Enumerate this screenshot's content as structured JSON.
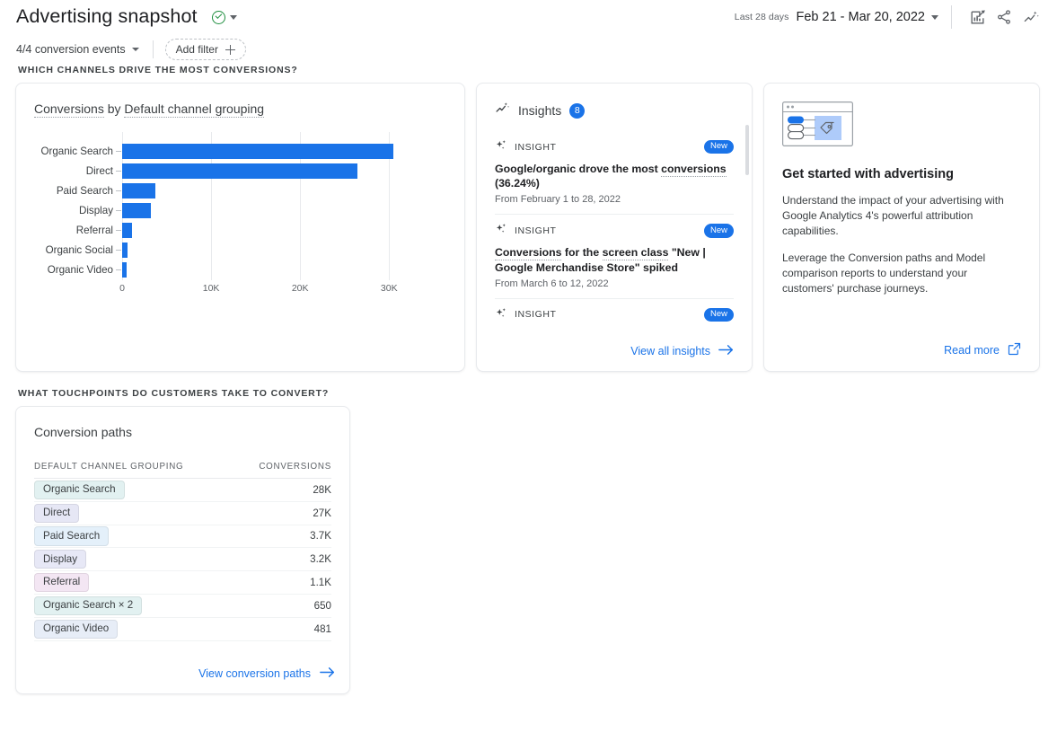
{
  "header": {
    "title": "Advertising snapshot",
    "status_icon": "check-circle-icon",
    "dropdown_icon": "chevron-down-icon",
    "last_days": "Last 28 days",
    "date_range": "Feb 21 - Mar 20, 2022",
    "actions": [
      {
        "name": "comparison-edit-icon",
        "title": "Edit comparisons"
      },
      {
        "name": "share-icon",
        "title": "Share this report"
      },
      {
        "name": "insights-icon",
        "title": "Insights"
      }
    ]
  },
  "filter_bar": {
    "conversion_events": "4/4 conversion events",
    "add_filter": "Add filter"
  },
  "sections": {
    "channels_question": "WHICH CHANNELS DRIVE THE MOST CONVERSIONS?",
    "touchpoints_question": "WHAT TOUCHPOINTS DO CUSTOMERS TAKE TO CONVERT?"
  },
  "chart_card": {
    "title_prefix": "Conversions",
    "title_middle": " by ",
    "title_suffix": "Default channel grouping"
  },
  "chart_data": {
    "type": "bar",
    "orientation": "horizontal",
    "title": "Conversions by Default channel grouping",
    "categories": [
      "Organic Search",
      "Direct",
      "Paid Search",
      "Display",
      "Referral",
      "Organic Social",
      "Organic Video"
    ],
    "values": [
      30500,
      26400,
      3700,
      3200,
      1100,
      650,
      481
    ],
    "xlabel": "",
    "ylabel": "",
    "xlim": [
      0,
      33000
    ],
    "xticks": [
      0,
      10000,
      20000,
      30000
    ],
    "xticklabels": [
      "0",
      "10K",
      "20K",
      "30K"
    ],
    "grid": true,
    "legend": false,
    "bar_color": "#1a73e8"
  },
  "insights": {
    "heading": "Insights",
    "count": "8",
    "icon": "insights-trend-icon",
    "items": [
      {
        "kind": "INSIGHT",
        "badge": "New",
        "title_a": "Google/organic drove the most ",
        "title_link": "conversions",
        "title_b": " (36.24%)",
        "date": "From February 1 to 28, 2022"
      },
      {
        "kind": "INSIGHT",
        "badge": "New",
        "title_a": "Conversions",
        "title_mid": " for the ",
        "title_link": "screen class",
        "title_b": " \"New | Google Merchandise Store\" spiked",
        "date": "From March 6 to 12, 2022"
      },
      {
        "kind": "INSIGHT",
        "badge": "New",
        "title_a": "",
        "title_link": "",
        "title_b": "",
        "date": ""
      }
    ],
    "view_all": "View all insights"
  },
  "promo": {
    "illustration": "advertising-card-illustration",
    "title": "Get started with advertising",
    "paragraph1": "Understand the impact of your advertising with Google Analytics 4's powerful attribution capabilities.",
    "paragraph2": "Leverage the Conversion paths and Model comparison reports to understand your customers' purchase journeys.",
    "read_more": "Read more"
  },
  "conversion_paths": {
    "title": "Conversion paths",
    "columns": [
      "DEFAULT CHANNEL GROUPING",
      "CONVERSIONS"
    ],
    "rows": [
      {
        "label": "Organic Search",
        "value": "28K",
        "chip_color": "#e2f1f1"
      },
      {
        "label": "Direct",
        "value": "27K",
        "chip_color": "#e6e7f5"
      },
      {
        "label": "Paid Search",
        "value": "3.7K",
        "chip_color": "#e4f0fa"
      },
      {
        "label": "Display",
        "value": "3.2K",
        "chip_color": "#e7e8f6"
      },
      {
        "label": "Referral",
        "value": "1.1K",
        "chip_color": "#f3e6f3"
      },
      {
        "label": "Organic Search × 2",
        "value": "650",
        "chip_color": "#e2f1f1"
      },
      {
        "label": "Organic Video",
        "value": "481",
        "chip_color": "#e7edf7"
      }
    ],
    "view_link": "View conversion paths"
  },
  "colors": {
    "accent": "#1a73e8",
    "bar": "#1a73e8",
    "success": "#1e8e3e",
    "text": "#202124",
    "muted": "#5f6368"
  }
}
